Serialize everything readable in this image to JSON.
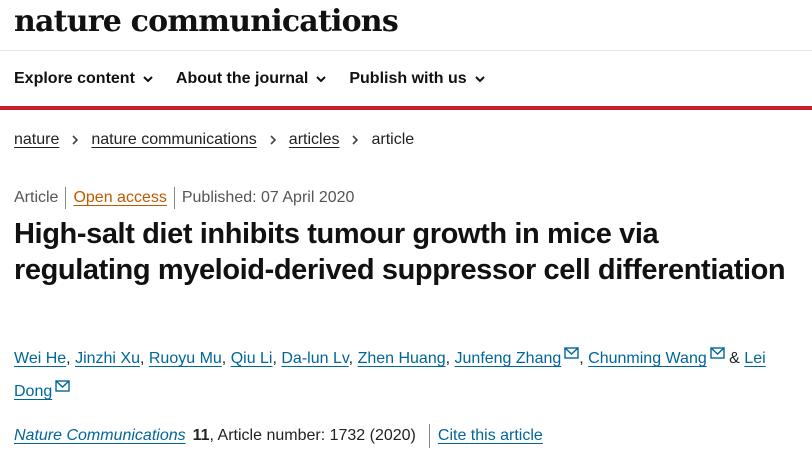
{
  "brand": "nature communications",
  "nav": [
    {
      "label": "Explore content"
    },
    {
      "label": "About the journal"
    },
    {
      "label": "Publish with us"
    }
  ],
  "breadcrumb": [
    "nature",
    "nature communications",
    "articles",
    "article"
  ],
  "meta": {
    "type": "Article",
    "access": "Open access",
    "published": "Published: 07 April 2020"
  },
  "title": "High-salt diet inhibits tumour growth in mice via regulating myeloid-derived suppressor cell differentiation",
  "authors": [
    {
      "name": "Wei He"
    },
    {
      "name": "Jinzhi Xu"
    },
    {
      "name": "Ruoyu Mu"
    },
    {
      "name": "Qiu Li"
    },
    {
      "name": "Da-lun Lv"
    },
    {
      "name": "Zhen Huang"
    },
    {
      "name": "Junfeng Zhang",
      "email": true
    },
    {
      "name": "Chunming Wang",
      "email": true
    },
    {
      "name": "Lei Dong",
      "email": true
    }
  ],
  "citation": {
    "journal": "Nature Communications",
    "volume": "11",
    "details": ", Article number: 1732 (2020)",
    "cite_label": "Cite this article"
  },
  "colors": {
    "accent_bar": "#c8202a",
    "link": "#006699",
    "open_access": "#c05a00"
  }
}
